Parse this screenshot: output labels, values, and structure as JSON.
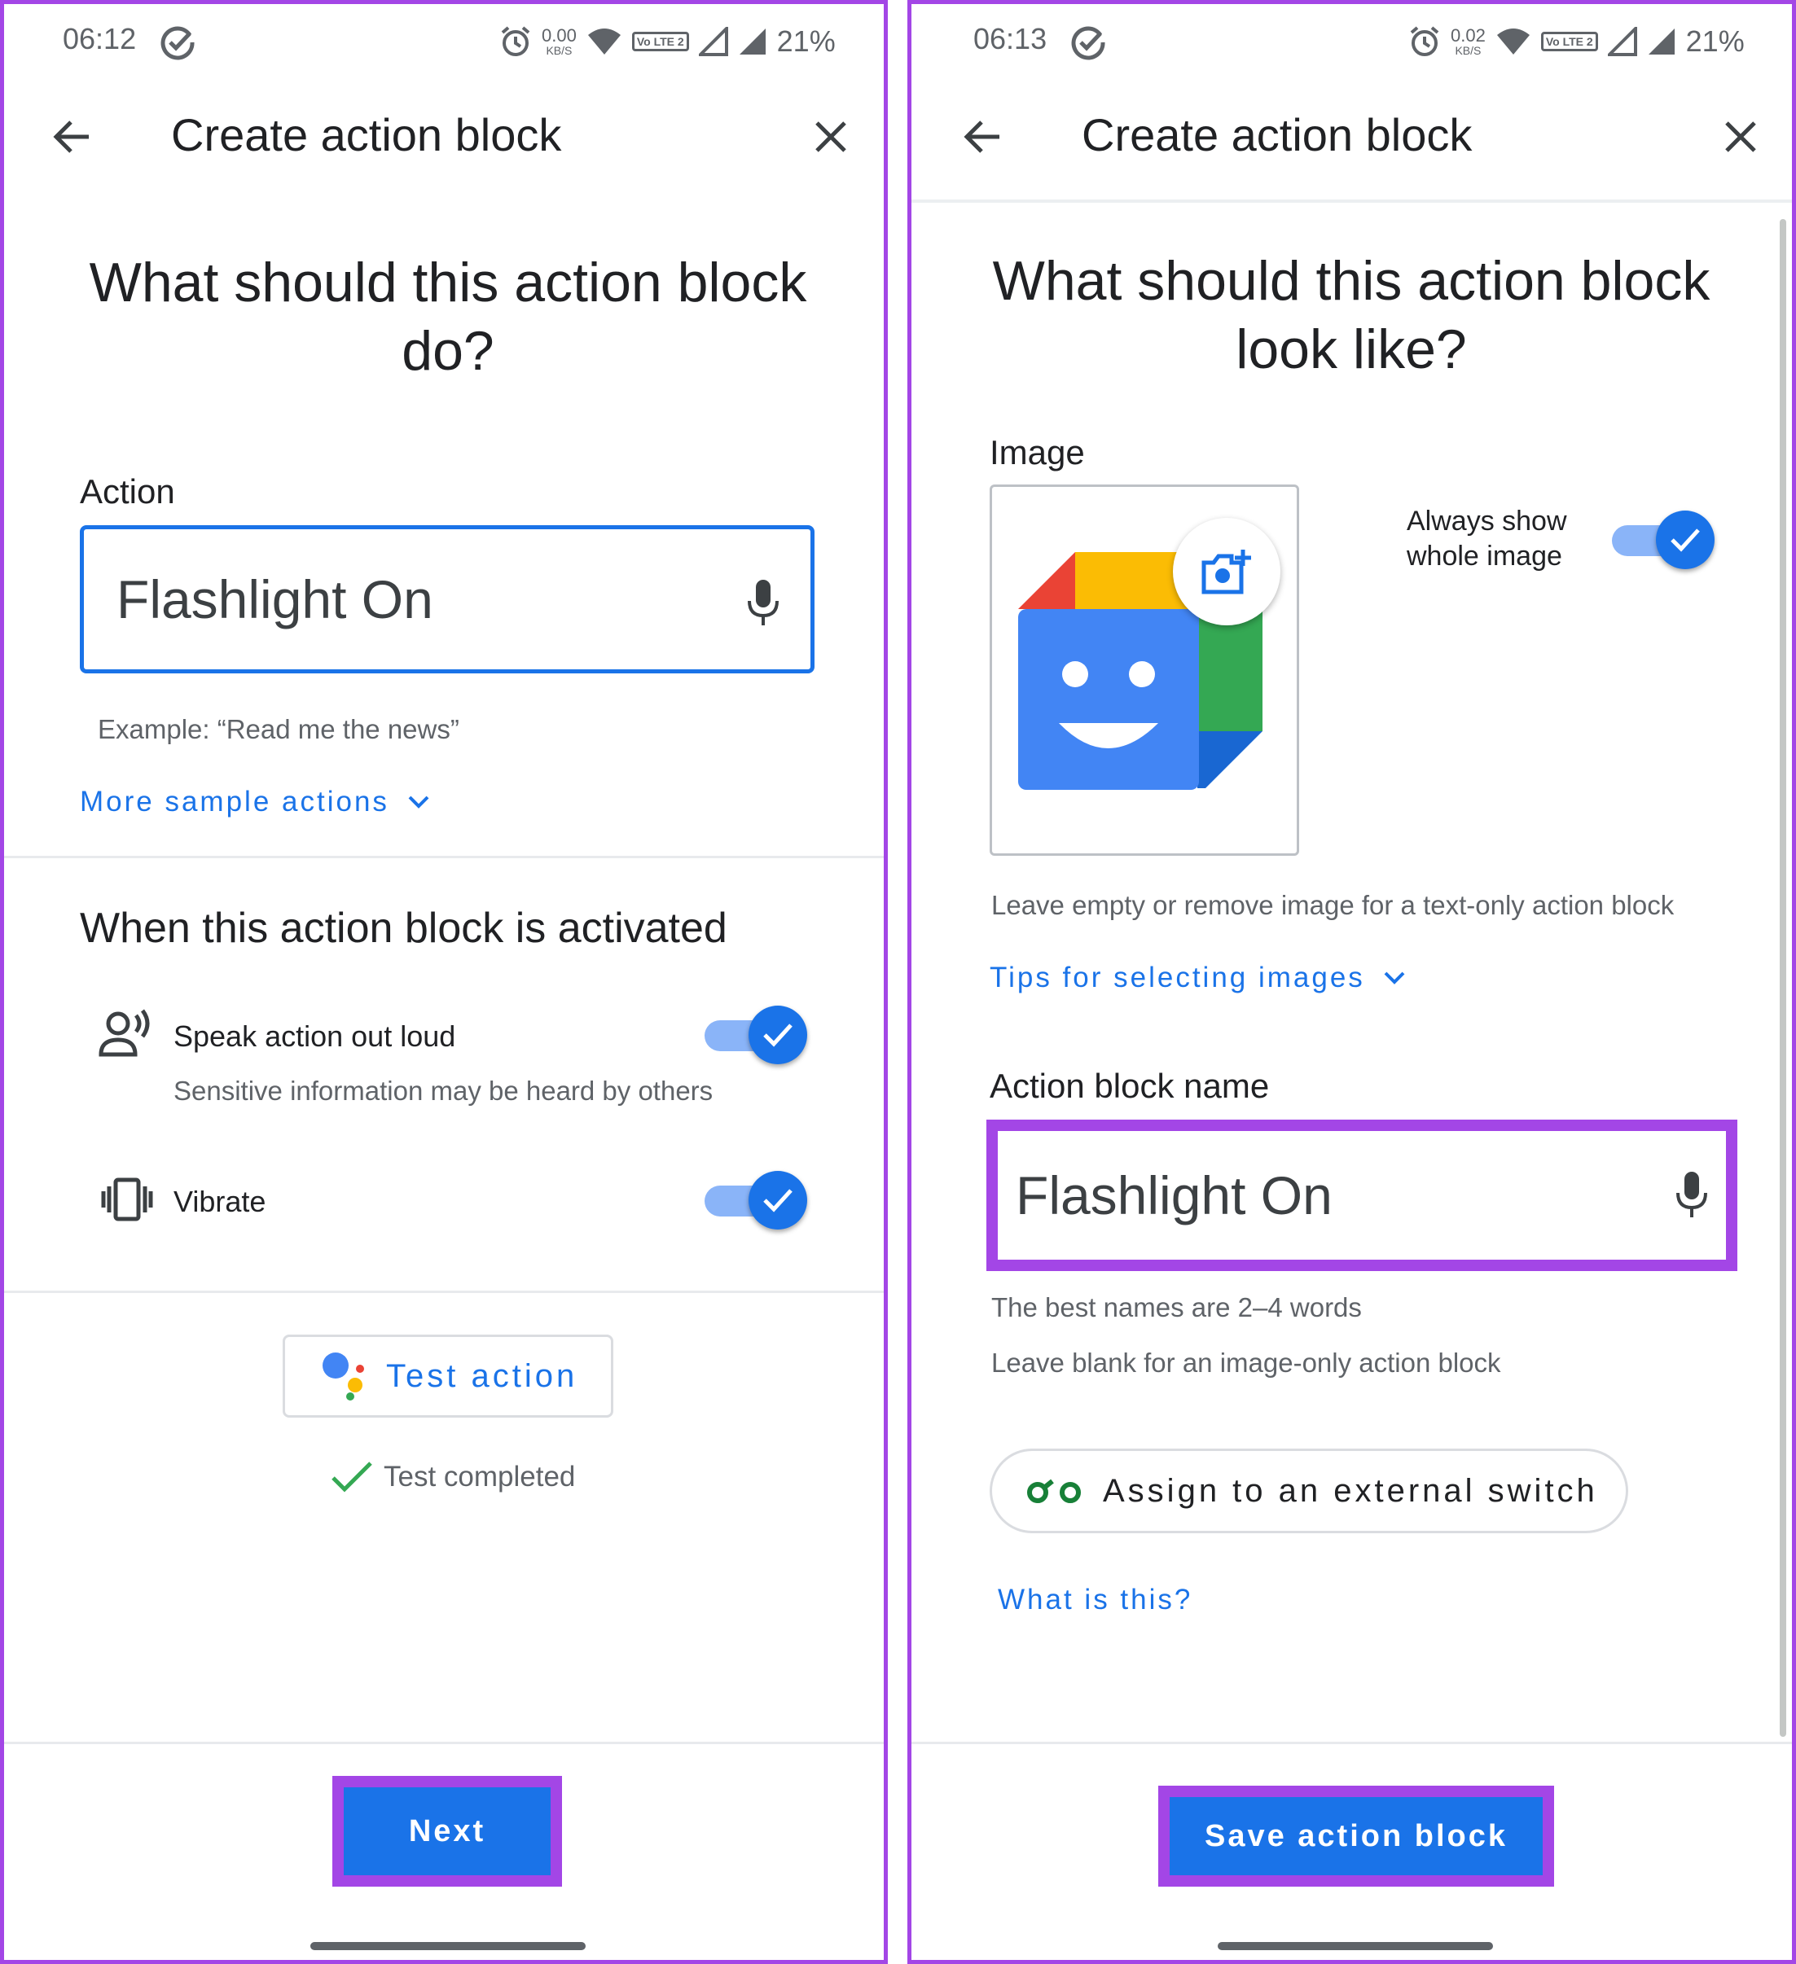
{
  "left_screen": {
    "status": {
      "time": "06:12",
      "net_speed": "0.00",
      "net_unit": "KB/S",
      "volte": "Vo LTE 2",
      "battery": "21%"
    },
    "header": {
      "title": "Create action block"
    },
    "heading": "What should this action block do?",
    "action": {
      "label": "Action",
      "value": "Flashlight On",
      "example": "Example: “Read me the news”",
      "more_samples": "More sample actions"
    },
    "activation": {
      "title": "When this action block is activated",
      "speak_label": "Speak action out loud",
      "speak_sub": "Sensitive information may be heard by others",
      "vibrate_label": "Vibrate"
    },
    "test": {
      "button": "Test action",
      "status": "Test completed"
    },
    "footer": {
      "next": "Next"
    }
  },
  "right_screen": {
    "status": {
      "time": "06:13",
      "net_speed": "0.02",
      "net_unit": "KB/S",
      "volte": "Vo LTE 2",
      "battery": "21%"
    },
    "header": {
      "title": "Create action block"
    },
    "heading": "What should this action block look like?",
    "image": {
      "label": "Image",
      "always_show": "Always show whole image",
      "helper": "Leave empty or remove image for a text-only action block",
      "tips": "Tips for selecting images"
    },
    "name": {
      "label": "Action block name",
      "value": "Flashlight On",
      "hint1": "The best names are 2–4 words",
      "hint2": "Leave blank for an image-only action block"
    },
    "switch": {
      "button": "Assign to an external switch",
      "what": "What is this?"
    },
    "footer": {
      "save": "Save action block"
    }
  },
  "colors": {
    "accent_blue": "#1a73e8",
    "toggle_track": "#8ab4f8",
    "highlight_purple": "#a346e6",
    "success_green": "#34a853"
  }
}
